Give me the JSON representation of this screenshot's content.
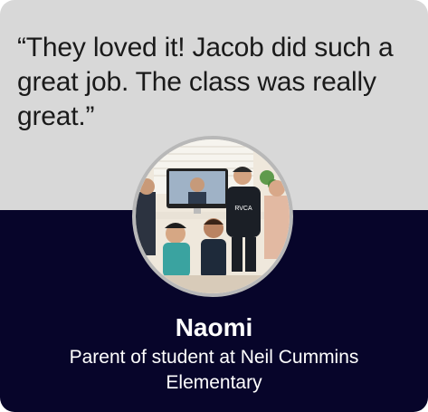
{
  "testimonial": {
    "quote": "“They loved it! Jacob did such a great job. The class was really great.”",
    "name": "Naomi",
    "role": "Parent of student at Neil Cummins Elementary",
    "photo_text": "RVCA"
  },
  "colors": {
    "top_background": "#d8d8d8",
    "bottom_background": "#07052a",
    "quote_text": "#1a1a1a",
    "name_text": "#ffffff",
    "photo_ring": "#b8b8b8"
  }
}
